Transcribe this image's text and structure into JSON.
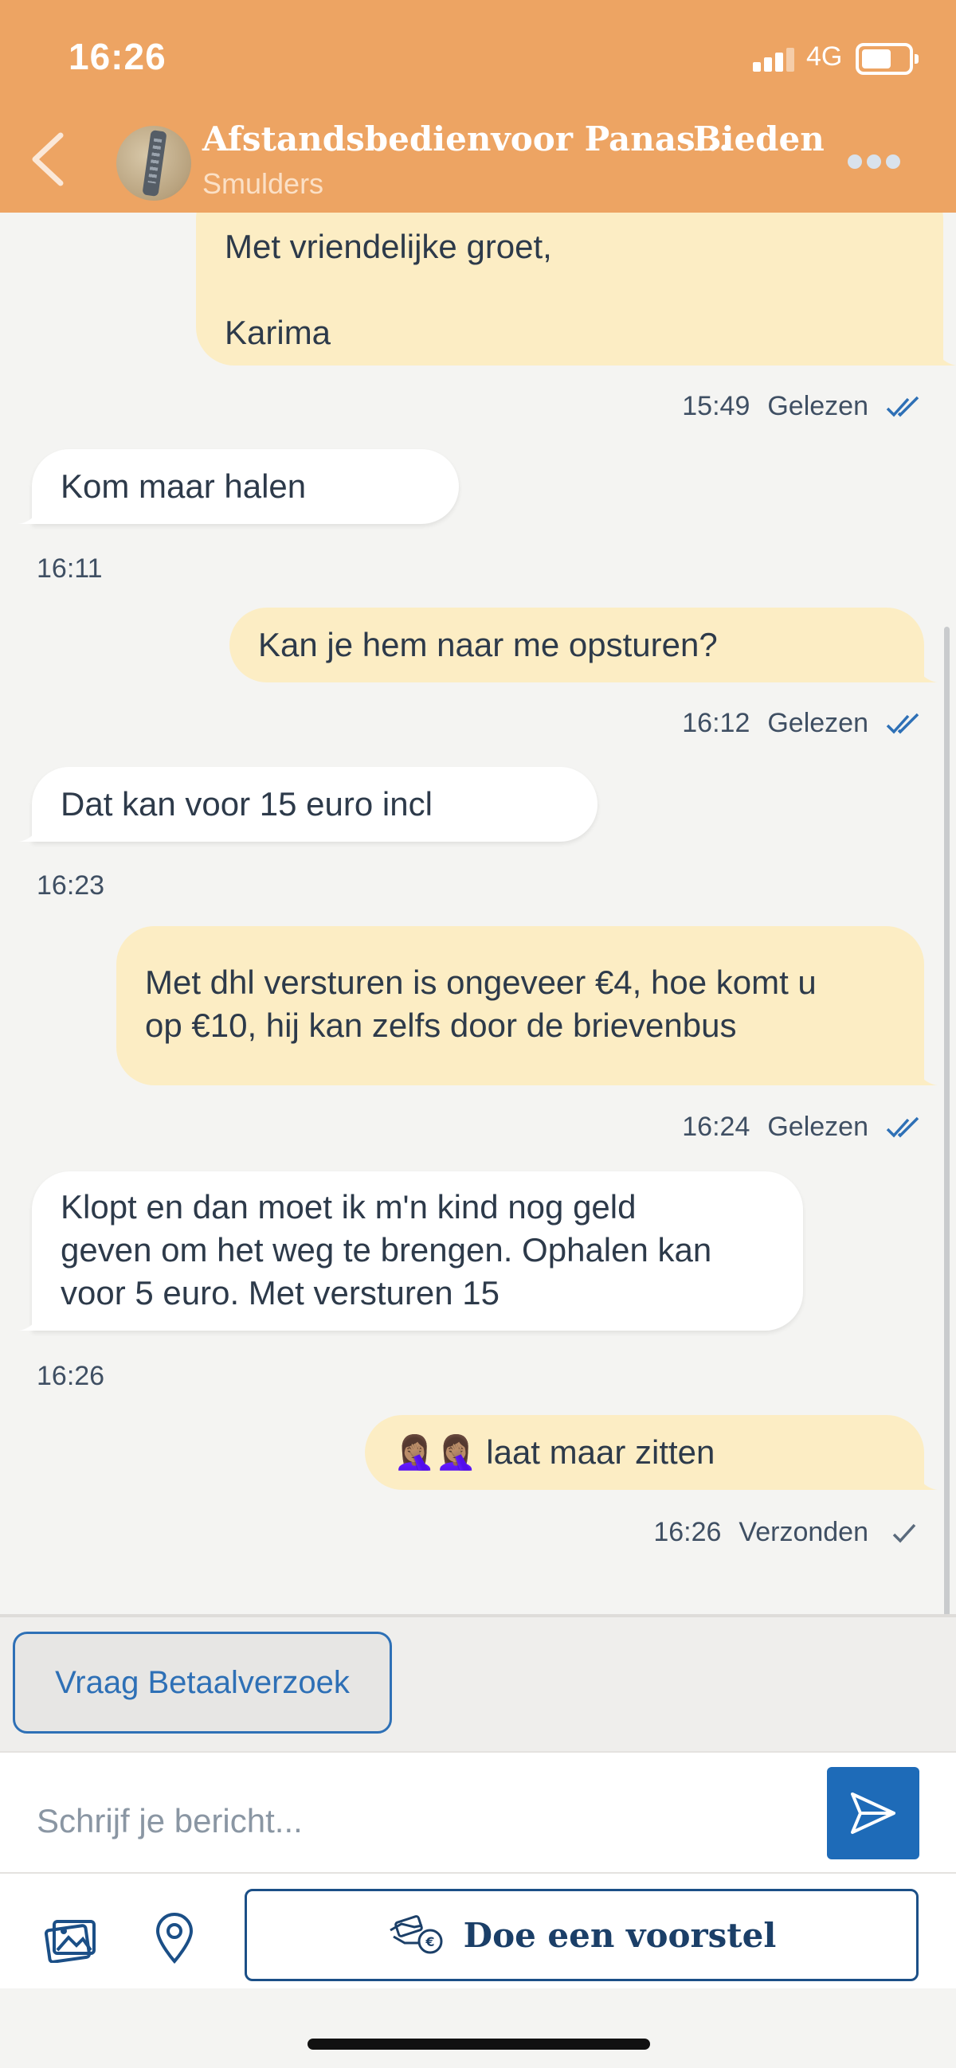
{
  "status_bar": {
    "time": "16:26",
    "network": "4G"
  },
  "header": {
    "product_title": "Afstandsbedienvoor Panas...",
    "seller": "Smulders",
    "bid_label": "Bieden"
  },
  "messages": [
    {
      "direction": "out",
      "lines": [
        "Met vriendelijke groet,",
        "",
        "Karima"
      ],
      "time": "15:49",
      "status": "Gelezen"
    },
    {
      "direction": "in",
      "lines": [
        "Kom maar halen"
      ],
      "time": "16:11"
    },
    {
      "direction": "out",
      "lines": [
        "Kan je hem naar me opsturen?"
      ],
      "time": "16:12",
      "status": "Gelezen"
    },
    {
      "direction": "in",
      "lines": [
        "Dat kan voor 15 euro incl"
      ],
      "time": "16:23"
    },
    {
      "direction": "out",
      "lines": [
        "Met dhl versturen is ongeveer €4, hoe komt u",
        "op €10, hij kan zelfs door de brievenbus"
      ],
      "time": "16:24",
      "status": "Gelezen"
    },
    {
      "direction": "in",
      "lines": [
        "Klopt en dan moet ik m'n kind nog geld",
        "geven om het weg te brengen. Ophalen kan",
        "voor 5 euro. Met versturen 15"
      ],
      "time": "16:26"
    },
    {
      "direction": "out",
      "lines": [
        "🤦🏽‍♀️🤦🏽‍♀️ laat maar zitten"
      ],
      "time": "16:26",
      "status": "Verzonden"
    }
  ],
  "actions": {
    "pay_request_label": "Vraag Betaalverzoek",
    "message_placeholder": "Schrijf je bericht...",
    "offer_label": "Doe een voorstel"
  },
  "colors": {
    "header": "#eda463",
    "outgoing_bubble": "#fcedc4",
    "incoming_bubble": "#ffffff",
    "accent_blue": "#1e6bb8",
    "read_check": "#2e70b6"
  },
  "icons": {
    "back": "chevron-left-icon",
    "more": "more-dots-icon",
    "read": "double-check-icon",
    "sent": "single-check-icon",
    "send": "send-icon",
    "photo": "photo-icon",
    "location": "location-pin-icon",
    "offer": "hand-money-icon"
  }
}
